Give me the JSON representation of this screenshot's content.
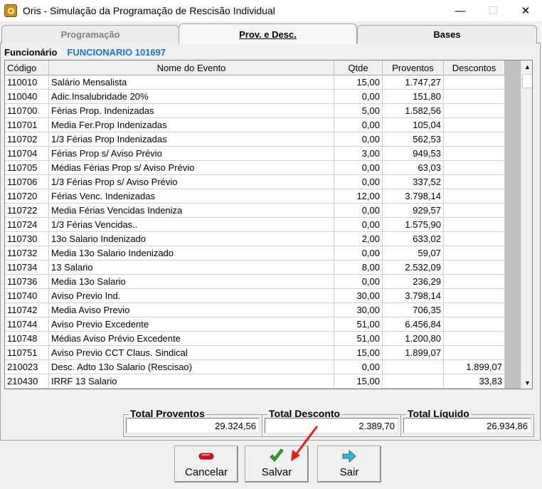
{
  "window": {
    "title": "Oris - Simulação da Programação de Rescisão Individual",
    "minimize_glyph": "—",
    "maximize_glyph": "☐",
    "close_glyph": "✕"
  },
  "tabs": [
    {
      "label": "Programação",
      "active": false
    },
    {
      "label": "Prov. e Desc.",
      "active": true
    },
    {
      "label": "Bases",
      "active": false
    }
  ],
  "funcionario": {
    "label": "Funcionário",
    "value": "FUNCIONARIO 101697"
  },
  "grid": {
    "columns": [
      "Código",
      "Nome do Evento",
      "Qtde",
      "Proventos",
      "Descontos"
    ],
    "rows": [
      [
        "110010",
        "Salário Mensalista",
        "15,00",
        "1.747,27",
        ""
      ],
      [
        "110040",
        "Adic.Insalubridade 20%",
        "0,00",
        "151,80",
        ""
      ],
      [
        "110700",
        "Férias Prop. Indenizadas",
        "5,00",
        "1.582,56",
        ""
      ],
      [
        "110701",
        "Media Fer.Prop Indenizadas",
        "0,00",
        "105,04",
        ""
      ],
      [
        "110702",
        "1/3 Férias Prop Indenizadas",
        "0,00",
        "562,53",
        ""
      ],
      [
        "110704",
        "Férias Prop s/ Aviso Prévio",
        "3,00",
        "949,53",
        ""
      ],
      [
        "110705",
        "Médias Férias Prop s/ Aviso Prévio",
        "0,00",
        "63,03",
        ""
      ],
      [
        "110706",
        "1/3 Férias Prop s/ Aviso Prévio",
        "0,00",
        "337,52",
        ""
      ],
      [
        "110720",
        "Férias Venc. Indenizadas",
        "12,00",
        "3.798,14",
        ""
      ],
      [
        "110722",
        "Media Férias Vencidas Indeniza",
        "0,00",
        "929,57",
        ""
      ],
      [
        "110724",
        "1/3 Férias Vencidas..",
        "0,00",
        "1.575,90",
        ""
      ],
      [
        "110730",
        "13o Salario Indenizado",
        "2,00",
        "633,02",
        ""
      ],
      [
        "110732",
        "Media 13o Salario Indenizado",
        "0,00",
        "59,07",
        ""
      ],
      [
        "110734",
        "13 Salario",
        "8,00",
        "2.532,09",
        ""
      ],
      [
        "110736",
        "Media 13o Salario",
        "0,00",
        "236,29",
        ""
      ],
      [
        "110740",
        "Aviso Previo Ind.",
        "30,00",
        "3.798,14",
        ""
      ],
      [
        "110742",
        "Media Aviso Previo",
        "30,00",
        "706,35",
        ""
      ],
      [
        "110744",
        "Aviso Previo Excedente",
        "51,00",
        "6.456,84",
        ""
      ],
      [
        "110748",
        "Médias Aviso Prévio Excedente",
        "51,00",
        "1.200,80",
        ""
      ],
      [
        "110751",
        "Aviso Previo CCT Claus. Sindical",
        "15,00",
        "1.899,07",
        ""
      ],
      [
        "210023",
        "Desc. Adto 13o Salario (Rescisao)",
        "0,00",
        "",
        "1.899,07"
      ],
      [
        "210430",
        "IRRF 13 Salario",
        "15,00",
        "",
        "33,83"
      ]
    ]
  },
  "totals": {
    "proventos_label": "Total Proventos",
    "proventos_value": "29.324,56",
    "desconto_label": "Total Desconto",
    "desconto_value": "2.389,70",
    "liquido_label": "Total Líquido",
    "liquido_value": "26.934,86"
  },
  "buttons": {
    "cancelar": "Cancelar",
    "salvar": "Salvar",
    "sair": "Sair"
  },
  "colors": {
    "funcionario_value": "#1a73d6",
    "cancel_icon": "#d9121a",
    "save_icon": "#2fa82f",
    "exit_icon": "#31b7d6",
    "annotation_arrow": "#e0201a"
  }
}
